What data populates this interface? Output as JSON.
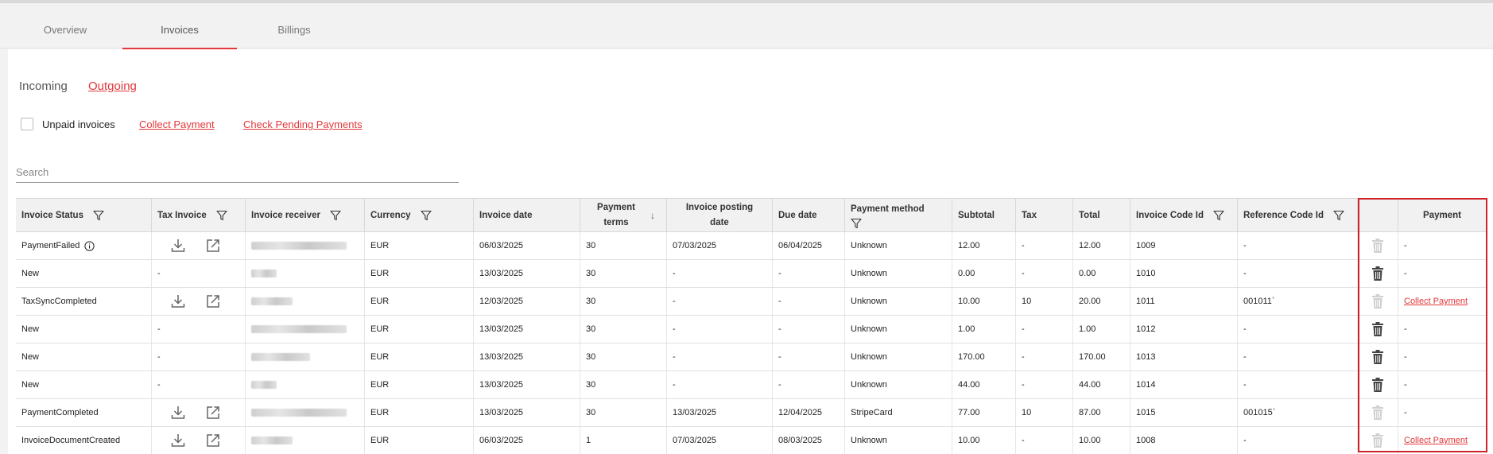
{
  "tabs": [
    {
      "label": "Overview",
      "active": false
    },
    {
      "label": "Invoices",
      "active": true
    },
    {
      "label": "Billings",
      "active": false
    }
  ],
  "subtabs": {
    "incoming": "Incoming",
    "outgoing": "Outgoing"
  },
  "filters": {
    "unpaid_label": "Unpaid invoices",
    "unpaid_checked": false,
    "collect_payment": "Collect Payment",
    "check_pending": "Check Pending Payments"
  },
  "search": {
    "placeholder": "Search",
    "value": ""
  },
  "columns": [
    {
      "label": "Invoice Status",
      "filter": true
    },
    {
      "label": "Tax Invoice",
      "filter": true
    },
    {
      "label": "Invoice receiver",
      "filter": true
    },
    {
      "label": "Currency",
      "filter": true
    },
    {
      "label": "Invoice date",
      "filter": false
    },
    {
      "label": "Payment terms",
      "filter": false,
      "sort": "desc"
    },
    {
      "label": "Invoice posting date",
      "filter": false
    },
    {
      "label": "Due date",
      "filter": false
    },
    {
      "label": "Payment method",
      "filter": true
    },
    {
      "label": "Subtotal",
      "filter": false
    },
    {
      "label": "Tax",
      "filter": false
    },
    {
      "label": "Total",
      "filter": false
    },
    {
      "label": "Invoice Code Id",
      "filter": true
    },
    {
      "label": "Reference Code Id",
      "filter": true
    },
    {
      "label": "",
      "filter": false
    },
    {
      "label": "Payment",
      "filter": false
    }
  ],
  "rows": [
    {
      "status": "PaymentFailed",
      "status_info": true,
      "tax_invoice": "icons",
      "receiver_blur": "long",
      "currency": "EUR",
      "invoice_date": "06/03/2025",
      "terms": "30",
      "posting_date": "07/03/2025",
      "due_date": "06/04/2025",
      "method": "Unknown",
      "subtotal": "12.00",
      "tax": "-",
      "total": "12.00",
      "code": "1009",
      "ref": "-",
      "delete_enabled": false,
      "payment": "-",
      "payment_link": false
    },
    {
      "status": "New",
      "status_info": false,
      "tax_invoice": "-",
      "receiver_blur": "short",
      "currency": "EUR",
      "invoice_date": "13/03/2025",
      "terms": "30",
      "posting_date": "-",
      "due_date": "-",
      "method": "Unknown",
      "subtotal": "0.00",
      "tax": "-",
      "total": "0.00",
      "code": "1010",
      "ref": "-",
      "delete_enabled": true,
      "payment": "-",
      "payment_link": false
    },
    {
      "status": "TaxSyncCompleted",
      "status_info": false,
      "tax_invoice": "icons",
      "receiver_blur": "medium",
      "currency": "EUR",
      "invoice_date": "12/03/2025",
      "terms": "30",
      "posting_date": "-",
      "due_date": "-",
      "method": "Unknown",
      "subtotal": "10.00",
      "tax": "10",
      "total": "20.00",
      "code": "1011",
      "ref": "001011`",
      "delete_enabled": false,
      "payment": "Collect Payment",
      "payment_link": true
    },
    {
      "status": "New",
      "status_info": false,
      "tax_invoice": "-",
      "receiver_blur": "long",
      "currency": "EUR",
      "invoice_date": "13/03/2025",
      "terms": "30",
      "posting_date": "-",
      "due_date": "-",
      "method": "Unknown",
      "subtotal": "1.00",
      "tax": "-",
      "total": "1.00",
      "code": "1012",
      "ref": "-",
      "delete_enabled": true,
      "payment": "-",
      "payment_link": false
    },
    {
      "status": "New",
      "status_info": false,
      "tax_invoice": "-",
      "receiver_blur": "mid",
      "currency": "EUR",
      "invoice_date": "13/03/2025",
      "terms": "30",
      "posting_date": "-",
      "due_date": "-",
      "method": "Unknown",
      "subtotal": "170.00",
      "tax": "-",
      "total": "170.00",
      "code": "1013",
      "ref": "-",
      "delete_enabled": true,
      "payment": "-",
      "payment_link": false
    },
    {
      "status": "New",
      "status_info": false,
      "tax_invoice": "-",
      "receiver_blur": "short",
      "currency": "EUR",
      "invoice_date": "13/03/2025",
      "terms": "30",
      "posting_date": "-",
      "due_date": "-",
      "method": "Unknown",
      "subtotal": "44.00",
      "tax": "-",
      "total": "44.00",
      "code": "1014",
      "ref": "-",
      "delete_enabled": true,
      "payment": "-",
      "payment_link": false
    },
    {
      "status": "PaymentCompleted",
      "status_info": false,
      "tax_invoice": "icons",
      "receiver_blur": "long",
      "currency": "EUR",
      "invoice_date": "13/03/2025",
      "terms": "30",
      "posting_date": "13/03/2025",
      "due_date": "12/04/2025",
      "method": "StripeCard",
      "subtotal": "77.00",
      "tax": "10",
      "total": "87.00",
      "code": "1015",
      "ref": "001015`",
      "delete_enabled": false,
      "payment": "-",
      "payment_link": false
    },
    {
      "status": "InvoiceDocumentCreated",
      "status_info": false,
      "tax_invoice": "icons",
      "receiver_blur": "medium",
      "currency": "EUR",
      "invoice_date": "06/03/2025",
      "terms": "1",
      "posting_date": "07/03/2025",
      "due_date": "08/03/2025",
      "method": "Unknown",
      "subtotal": "10.00",
      "tax": "-",
      "total": "10.00",
      "code": "1008",
      "ref": "-",
      "delete_enabled": false,
      "payment": "Collect Payment",
      "payment_link": true
    }
  ],
  "colors": {
    "accent": "#e2383b",
    "highlight_border": "#d0242b"
  }
}
